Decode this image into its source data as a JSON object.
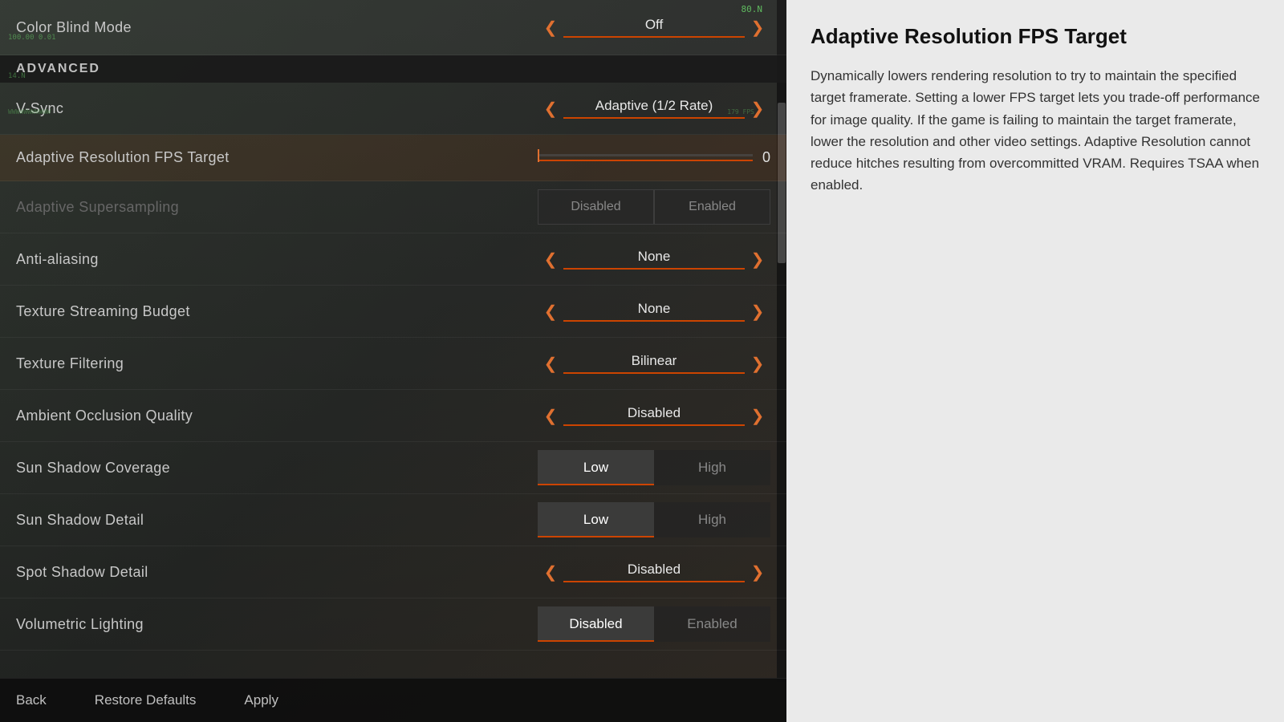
{
  "settings_panel": {
    "color_blind_mode": {
      "label": "Color Blind Mode",
      "value": "Off",
      "underline_color": "#cc4400"
    },
    "advanced_header": "ADVANCED",
    "vsync": {
      "label": "V-Sync",
      "value": "Adaptive (1/2 Rate)"
    },
    "adaptive_resolution": {
      "label": "Adaptive Resolution FPS Target",
      "value": "0"
    },
    "adaptive_supersampling": {
      "label": "Adaptive Supersampling",
      "option1": "Disabled",
      "option2": "Enabled",
      "selected": "none"
    },
    "anti_aliasing": {
      "label": "Anti-aliasing",
      "value": "None"
    },
    "texture_streaming": {
      "label": "Texture Streaming Budget",
      "value": "None"
    },
    "texture_filtering": {
      "label": "Texture Filtering",
      "value": "Bilinear"
    },
    "ambient_occlusion": {
      "label": "Ambient Occlusion Quality",
      "value": "Disabled"
    },
    "sun_shadow_coverage": {
      "label": "Sun Shadow Coverage",
      "option1": "Low",
      "option2": "High",
      "selected": "option1"
    },
    "sun_shadow_detail": {
      "label": "Sun Shadow Detail",
      "option1": "Low",
      "option2": "High",
      "selected": "option1"
    },
    "spot_shadow_detail": {
      "label": "Spot Shadow Detail",
      "value": "Disabled"
    },
    "volumetric_lighting": {
      "label": "Volumetric Lighting",
      "option1": "Disabled",
      "option2": "Enabled",
      "selected": "option1"
    }
  },
  "bottom_bar": {
    "back_label": "Back",
    "restore_label": "Restore Defaults",
    "apply_label": "Apply"
  },
  "description_panel": {
    "title": "Adaptive Resolution FPS Target",
    "body": "Dynamically lowers rendering resolution to try to maintain the specified target framerate. Setting a lower FPS target lets you trade-off performance for image quality. If the game is failing to maintain the target framerate, lower the resolution and other video settings. Adaptive Resolution cannot reduce hitches resulting from overcommitted VRAM. Requires TSAA when enabled."
  }
}
